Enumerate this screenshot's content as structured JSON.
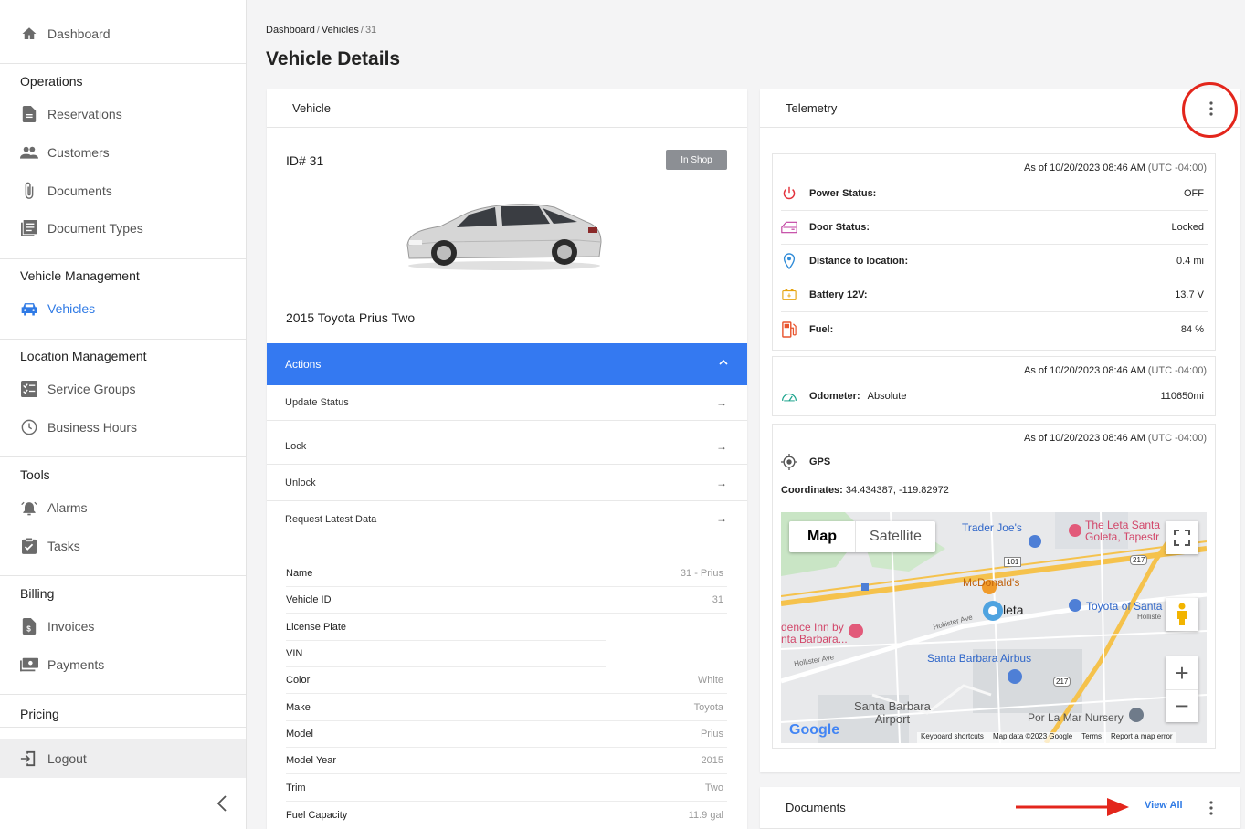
{
  "sidebar": {
    "dashboard": "Dashboard",
    "operations": {
      "title": "Operations",
      "items": [
        "Reservations",
        "Customers",
        "Documents",
        "Document Types"
      ]
    },
    "vehicle_management": {
      "title": "Vehicle Management",
      "items": [
        "Vehicles"
      ]
    },
    "location_management": {
      "title": "Location Management",
      "items": [
        "Service Groups",
        "Business Hours"
      ]
    },
    "tools": {
      "title": "Tools",
      "items": [
        "Alarms",
        "Tasks"
      ]
    },
    "billing": {
      "title": "Billing",
      "items": [
        "Invoices",
        "Payments"
      ]
    },
    "pricing": {
      "title": "Pricing"
    },
    "logout": "Logout",
    "active_color": "#2f7ae5"
  },
  "breadcrumb": {
    "root": "Dashboard",
    "sep": "/",
    "section": "Vehicles",
    "current": "31"
  },
  "page_title": "Vehicle Details",
  "vehicle_card": {
    "header": "Vehicle",
    "id_label": "ID# 31",
    "status_badge": "In Shop",
    "name": "2015 Toyota Prius Two",
    "actions_label": "Actions",
    "actions": [
      "Update Status",
      "Lock",
      "Unlock",
      "Request Latest Data"
    ],
    "details": [
      {
        "label": "Name",
        "value": "31 - Prius"
      },
      {
        "label": "Vehicle ID",
        "value": "31"
      },
      {
        "label": "License Plate",
        "value": ""
      },
      {
        "label": "VIN",
        "value": ""
      },
      {
        "label": "Color",
        "value": "White"
      },
      {
        "label": "Make",
        "value": "Toyota"
      },
      {
        "label": "Model",
        "value": "Prius"
      },
      {
        "label": "Model Year",
        "value": "2015"
      },
      {
        "label": "Trim",
        "value": "Two"
      },
      {
        "label": "Fuel Capacity",
        "value": "11.9 gal"
      }
    ],
    "actions_bar_color": "#3479f1"
  },
  "telemetry": {
    "header": "Telemetry",
    "status_box": {
      "as_of_prefix": "As of ",
      "as_of_time": "10/20/2023 08:46 AM",
      "as_of_tz": " (UTC -04:00)",
      "rows": [
        {
          "label": "Power Status:",
          "value": "OFF",
          "icon": "power-icon"
        },
        {
          "label": "Door Status:",
          "value": "Locked",
          "icon": "door-icon"
        },
        {
          "label": "Distance to location:",
          "value": "0.4 mi",
          "icon": "location-pin-icon"
        },
        {
          "label": "Battery 12V:",
          "value": "13.7 V",
          "icon": "battery-icon"
        },
        {
          "label": "Fuel:",
          "value": "84 %",
          "icon": "fuel-icon"
        }
      ]
    },
    "odometer_box": {
      "as_of_prefix": "As of ",
      "as_of_time": "10/20/2023 08:46 AM",
      "as_of_tz": " (UTC -04:00)",
      "label": "Odometer:",
      "sublabel": "Absolute",
      "value": "110650mi"
    },
    "gps_box": {
      "as_of_prefix": "As of ",
      "as_of_time": "10/20/2023 08:46 AM",
      "as_of_tz": " (UTC -04:00)",
      "label": "GPS",
      "coords_label": "Coordinates:",
      "coords_value": "34.434387, -119.82972"
    },
    "map": {
      "tab_map": "Map",
      "tab_satellite": "Satellite",
      "places": [
        "Trader Joe's",
        "McDonald's",
        "The Leta Santa",
        "Goleta, Tapestr",
        "Toyota of Santa",
        "dence Inn by",
        "nta Barbara...",
        "Santa Barbara Airbus",
        "Santa Barbara",
        "Airport",
        "Por La Mar Nursery",
        "leta",
        "Hollister Ave",
        "Hollister Ave",
        "Holliste"
      ],
      "shields": [
        "101",
        "217",
        "217"
      ],
      "logo": "Google",
      "footer": [
        "Keyboard shortcuts",
        "Map data ©2023 Google",
        "Terms",
        "Report a map error"
      ],
      "zoom_in": "+",
      "zoom_out": "−"
    }
  },
  "documents": {
    "header": "Documents",
    "view_all": "View All"
  },
  "annotations": {
    "circle_color": "#e3261c",
    "arrow_color": "#e3261c"
  }
}
